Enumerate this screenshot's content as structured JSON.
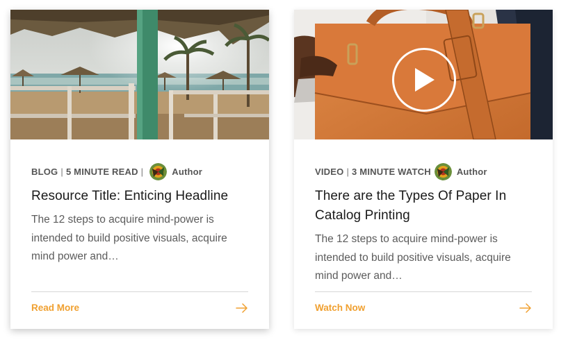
{
  "cards": [
    {
      "type_label": "BLOG",
      "duration_label": "5 MINUTE READ",
      "separator": "|",
      "author": "Author",
      "title": "Resource Title: Enticing Headline",
      "excerpt": "The 12 steps to acquire mind-power is intended to build positive visuals, acquire mind power and…",
      "cta_label": "Read More",
      "media_icon": "beach-photo"
    },
    {
      "type_label": "VIDEO",
      "duration_label": "3 MINUTE WATCH",
      "separator": "|",
      "author": "Author",
      "title": "There are the Types Of Paper In Catalog Printing",
      "excerpt": "The 12 steps to acquire mind-power is intended to build positive visuals, acquire mind power and…",
      "cta_label": "Watch Now",
      "media_icon": "leather-bag-photo"
    }
  ],
  "colors": {
    "accent": "#f0a030",
    "title": "#1a1a1a",
    "body_text": "#5b5b5b",
    "divider": "#d6d6d6"
  }
}
